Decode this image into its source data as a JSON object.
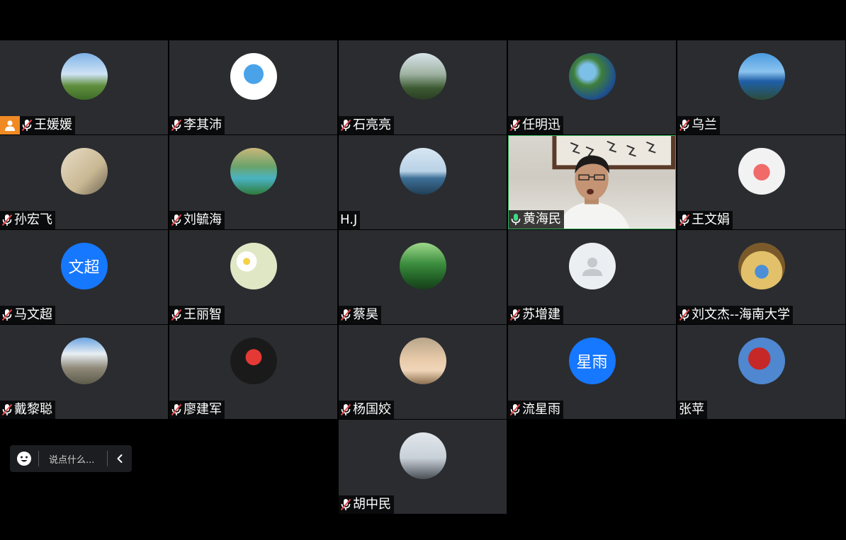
{
  "participants": [
    {
      "name": "王媛媛",
      "muted": true,
      "host": true,
      "avatar": "sky-meadow-photo"
    },
    {
      "name": "李其沛",
      "muted": true,
      "avatar": "smurf-cartoon"
    },
    {
      "name": "石亮亮",
      "muted": true,
      "avatar": "mountain-person-photo"
    },
    {
      "name": "任明迅",
      "muted": true,
      "avatar": "earth-globe"
    },
    {
      "name": "乌兰",
      "muted": true,
      "avatar": "ocean-coast-photo"
    },
    {
      "name": "孙宏飞",
      "muted": true,
      "avatar": "shadow-sand-photo"
    },
    {
      "name": "刘毓海",
      "muted": true,
      "avatar": "waterfall-painting"
    },
    {
      "name": "H.J",
      "muted": false,
      "mic_hidden": true,
      "avatar": "sea-horizon-photo"
    },
    {
      "name": "黄海民",
      "muted": false,
      "speaking": true,
      "video": true
    },
    {
      "name": "王文娟",
      "muted": true,
      "avatar": "pig-cartoon"
    },
    {
      "name": "马文超",
      "muted": true,
      "avatar_text": "文超",
      "avatar_color": "#1677ff"
    },
    {
      "name": "王丽智",
      "muted": true,
      "avatar": "daisy-photo"
    },
    {
      "name": "蔡昊",
      "muted": true,
      "avatar": "green-forest-photo"
    },
    {
      "name": "苏增建",
      "muted": true,
      "avatar": "default-person"
    },
    {
      "name": "刘文杰--海南大学",
      "muted": true,
      "avatar": "tree-globe-illustration"
    },
    {
      "name": "戴黎聪",
      "muted": true,
      "avatar": "snow-mountain-photo"
    },
    {
      "name": "廖建军",
      "muted": true,
      "avatar": "mario-cartoon"
    },
    {
      "name": "杨国姣",
      "muted": true,
      "avatar": "woman-cap-photo"
    },
    {
      "name": "流星雨",
      "muted": true,
      "avatar_text": "星雨",
      "avatar_color": "#1677ff"
    },
    {
      "name": "张苹",
      "muted": false,
      "mic_hidden": true,
      "avatar": "red-blossom-photo"
    },
    {
      "name": "胡中民",
      "muted": true,
      "avatar": "two-people-photo"
    }
  ],
  "chat": {
    "placeholder": "说点什么..."
  },
  "colors": {
    "tile_bg": "#2a2c30",
    "speaking_border": "#2fae55",
    "host_badge": "#f08a24",
    "muted_slash": "#e5484d",
    "text_avatar": "#1677ff"
  }
}
